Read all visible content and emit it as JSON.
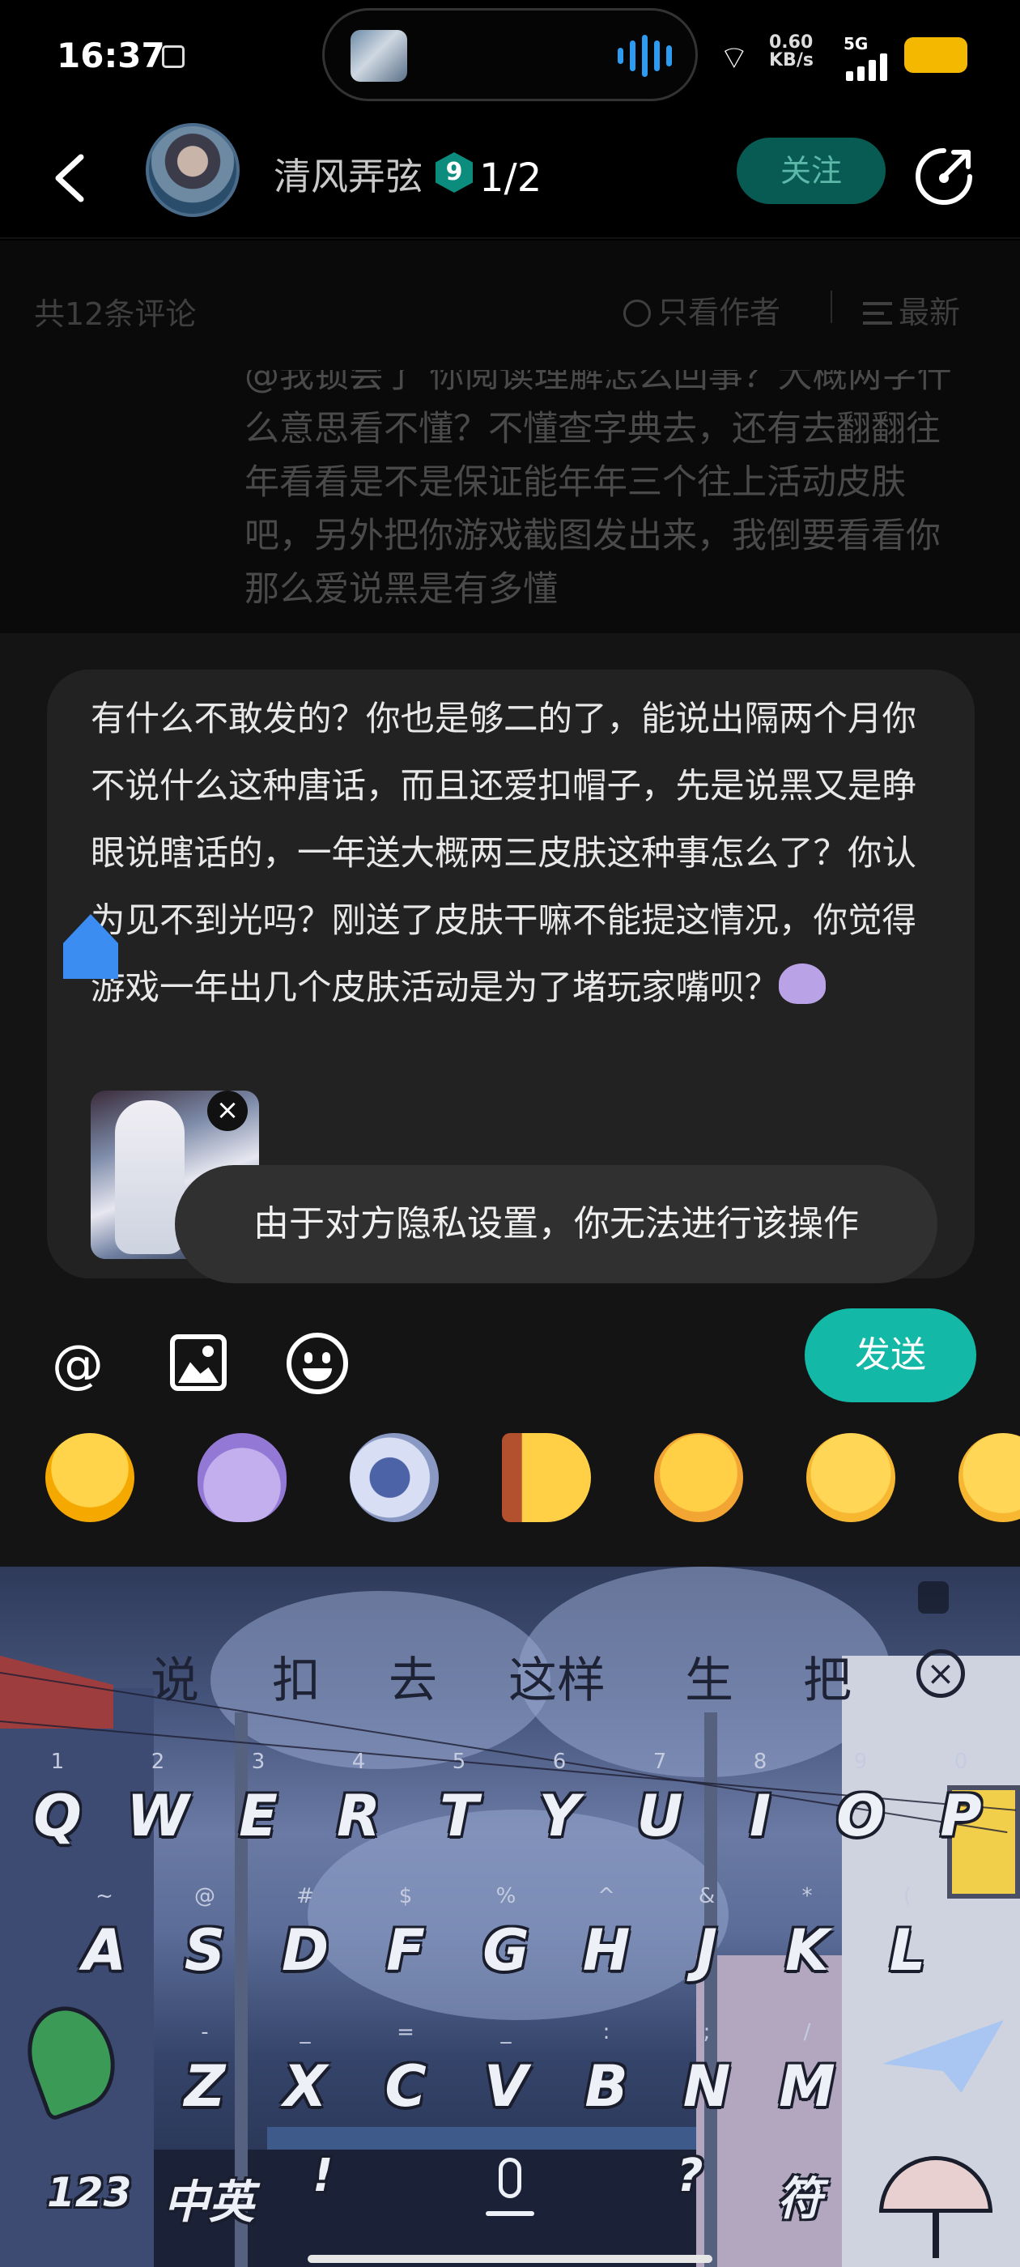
{
  "status_bar": {
    "time": "16:37",
    "network_speed": "0.60\nKB/s",
    "network_type": "5G",
    "battery_color": "#f5b800"
  },
  "header": {
    "author_name": "清风弄弦",
    "level": "9",
    "page_counter": "1/2",
    "follow_label": "关注",
    "icons": [
      "back-icon",
      "share-icon"
    ]
  },
  "comments_bar": {
    "count_label": "共12条评论",
    "author_only_label": "只看作者",
    "sort_label": "最新"
  },
  "background_reply": {
    "text": "@我锁尝了 你阅读理解怎么回事？大概两字什么意思看不懂？不懂查字典去，还有去翻翻往年看看是不是保证能年年三个往上活动皮肤吧，另外把你游戏截图发出来，我倒要看看你那么爱说黑是有多懂"
  },
  "compose": {
    "text": "有什么不敢发的？你也是够二的了，能说出隔两个月你不说什么这种唐话，而且还爱扣帽子，先是说黑又是睁眼说瞎话的，一年送大概两三皮肤这种事怎么了？你认为见不到光吗？刚送了皮肤干嘛不能提这情况，你觉得游戏一年出几个皮肤活动是为了堵玩家嘴呗？",
    "attachment_close": "×",
    "toast": "由于对方隐私设置，你无法进行该操作"
  },
  "toolbar": {
    "mention": "@",
    "send_label": "发送",
    "accent_color": "#13b8a6",
    "icons": [
      "at-icon",
      "image-icon",
      "emoji-icon"
    ]
  },
  "stickers": [
    "crying-face-sticker",
    "purple-blob-sticker",
    "astronaut-sticker",
    "peeking-wall-sticker",
    "watermelon-sticker",
    "smirk-sticker",
    "smug-sticker"
  ],
  "keyboard": {
    "suggestions": [
      "说",
      "扣",
      "去",
      "这样",
      "生",
      "把"
    ],
    "row1": [
      {
        "key": "Q",
        "hint": "1"
      },
      {
        "key": "W",
        "hint": "2"
      },
      {
        "key": "E",
        "hint": "3"
      },
      {
        "key": "R",
        "hint": "4"
      },
      {
        "key": "T",
        "hint": "5"
      },
      {
        "key": "Y",
        "hint": "6"
      },
      {
        "key": "U",
        "hint": "7"
      },
      {
        "key": "I",
        "hint": "8"
      },
      {
        "key": "O",
        "hint": "9"
      },
      {
        "key": "P",
        "hint": "0"
      }
    ],
    "row2": [
      {
        "key": "A",
        "hint": "~"
      },
      {
        "key": "S",
        "hint": "@"
      },
      {
        "key": "D",
        "hint": "#"
      },
      {
        "key": "F",
        "hint": "$"
      },
      {
        "key": "G",
        "hint": "%"
      },
      {
        "key": "H",
        "hint": "^"
      },
      {
        "key": "J",
        "hint": "&"
      },
      {
        "key": "K",
        "hint": "*"
      },
      {
        "key": "L",
        "hint": "("
      }
    ],
    "row3": [
      {
        "key": "Z",
        "hint": "-"
      },
      {
        "key": "X",
        "hint": "_"
      },
      {
        "key": "C",
        "hint": "="
      },
      {
        "key": "V",
        "hint": "_"
      },
      {
        "key": "B",
        "hint": ":"
      },
      {
        "key": "N",
        "hint": ";"
      },
      {
        "key": "M",
        "hint": "/"
      }
    ],
    "bottom": {
      "numbers": "123",
      "lang": "中英",
      "exclaim": "!",
      "question": "?",
      "symbols": "符"
    }
  }
}
